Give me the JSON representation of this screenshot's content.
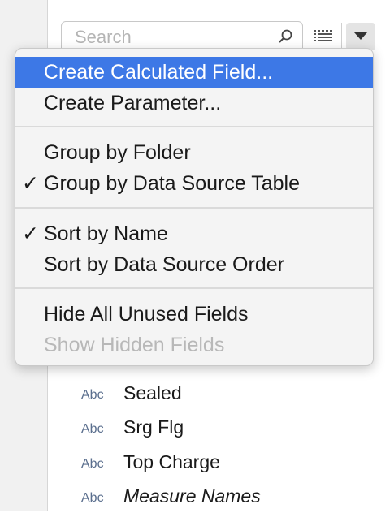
{
  "search": {
    "placeholder": "Search"
  },
  "icons": {
    "search": "magnifier-icon",
    "list_view": "list-view-icon",
    "menu": "triangle-down-icon"
  },
  "colors": {
    "highlight": "#3d78e6",
    "menu_bg": "#f4f4f4",
    "disabled_text": "#b8b8b8",
    "field_type": "#5b6f8e"
  },
  "menu": {
    "items": [
      {
        "label": "Create Calculated Field...",
        "checked": false,
        "highlighted": true,
        "disabled": false
      },
      {
        "label": "Create Parameter...",
        "checked": false,
        "highlighted": false,
        "disabled": false
      },
      {
        "label": "Group by Folder",
        "checked": false,
        "highlighted": false,
        "disabled": false
      },
      {
        "label": "Group by Data Source Table",
        "checked": true,
        "highlighted": false,
        "disabled": false
      },
      {
        "label": "Sort by Name",
        "checked": true,
        "highlighted": false,
        "disabled": false
      },
      {
        "label": "Sort by Data Source Order",
        "checked": false,
        "highlighted": false,
        "disabled": false
      },
      {
        "label": "Hide All Unused Fields",
        "checked": false,
        "highlighted": false,
        "disabled": false
      },
      {
        "label": "Show Hidden Fields",
        "checked": false,
        "highlighted": false,
        "disabled": true
      }
    ],
    "check_glyph": "✓"
  },
  "fields": [
    {
      "type": "Abc",
      "name": "Sealed",
      "italic": false
    },
    {
      "type": "Abc",
      "name": "Srg Flg",
      "italic": false
    },
    {
      "type": "Abc",
      "name": "Top Charge",
      "italic": false
    },
    {
      "type": "Abc",
      "name": "Measure Names",
      "italic": true
    }
  ]
}
